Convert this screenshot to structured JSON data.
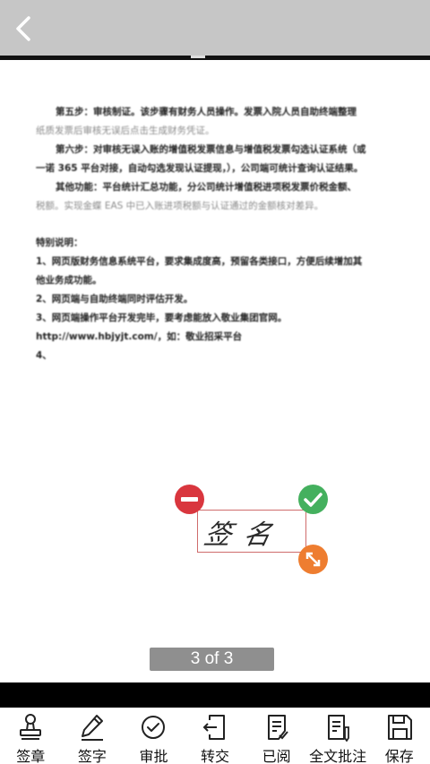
{
  "header": {
    "back_icon": "chevron-left-icon"
  },
  "document": {
    "lines": [
      {
        "text": "第五步：审核制证。该步骤有财务人员操作。发票入院人员自助终端整理",
        "style": "indent-strong"
      },
      {
        "text": "纸质发票后审核无误后点击生成财务凭证。",
        "style": "light"
      },
      {
        "text": "第六步：对审核无误入账的增值税发票信息与增值税发票勾选认证系统（或",
        "style": "indent-strong"
      },
      {
        "text": "一诺 365 平台对接，自动勾选发现认证提现，），公司端可统计查询认证结果。",
        "style": "strong"
      },
      {
        "text": "其他功能：平台统计汇总功能，分公司统计增值税进项税发票价税金额、",
        "style": "indent-strong"
      },
      {
        "text": "税额。实现金蝶 EAS 中已入账进项税额与认证通过的金额核对差异。",
        "style": "light"
      },
      {
        "text": "",
        "style": "gap"
      },
      {
        "text": "特别说明：",
        "style": "strong"
      },
      {
        "text": "1、网页版财务信息系统平台，要求集成度高，预留各类接口，方便后续增加其",
        "style": "strong"
      },
      {
        "text": "他业务成功能。",
        "style": "strong"
      },
      {
        "text": "2、网页端与自助终端同时评估开发。",
        "style": "strong"
      },
      {
        "text": "3、网页端操作平台开发完毕，要考虑能放入敬业集团官网。",
        "style": "strong"
      },
      {
        "text": "http://www.hbjyjt.com/，如：敬业招采平台",
        "style": "strong"
      },
      {
        "text": "4、",
        "style": "strong"
      }
    ]
  },
  "signature": {
    "text": "签名",
    "remove_icon": "minus-circle-icon",
    "confirm_icon": "check-circle-icon",
    "resize_icon": "resize-arrows-icon"
  },
  "pager": {
    "label": "3 of 3"
  },
  "toolbar": {
    "items": [
      {
        "label": "签章",
        "icon": "stamp-icon"
      },
      {
        "label": "签字",
        "icon": "pen-icon"
      },
      {
        "label": "审批",
        "icon": "check-circle-icon"
      },
      {
        "label": "转交",
        "icon": "forward-document-icon"
      },
      {
        "label": "已阅",
        "icon": "read-document-icon"
      },
      {
        "label": "全文批注",
        "icon": "annotate-document-icon"
      },
      {
        "label": "保存",
        "icon": "floppy-disk-icon"
      }
    ]
  },
  "colors": {
    "header_bg": "#c6c6c6",
    "remove": "#d9363e",
    "confirm": "#44b05e",
    "resize": "#ee7d30",
    "signature_border": "#cf6c6c"
  }
}
